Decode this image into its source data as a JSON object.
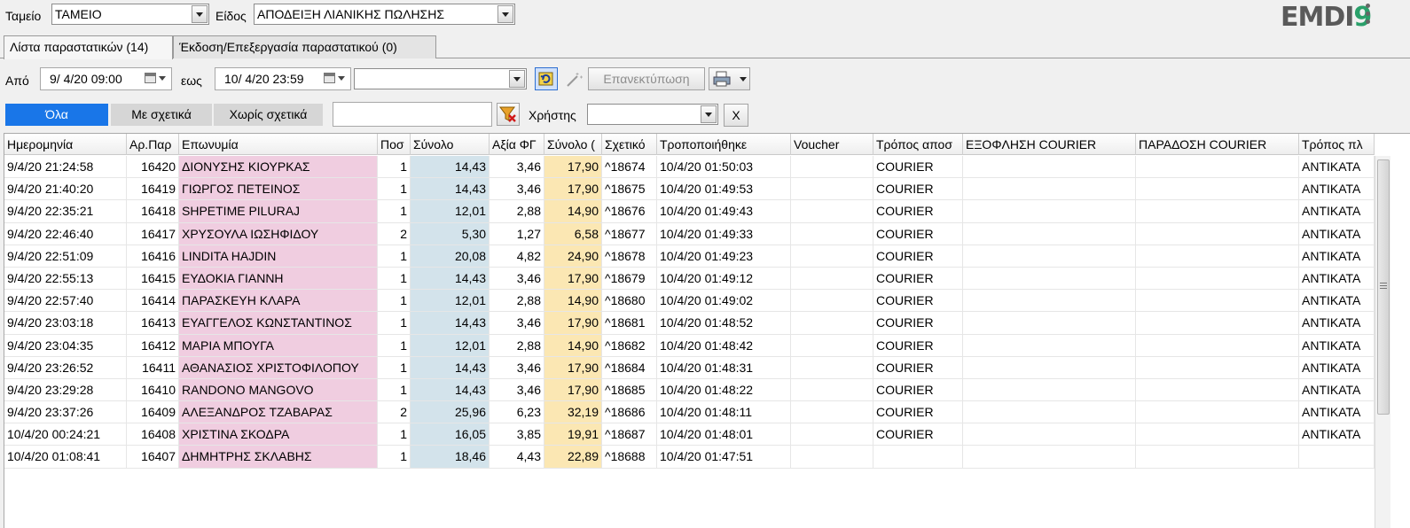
{
  "top": {
    "cashier_label": "Ταμείο",
    "cashier_value": "ΤΑΜΕΙΟ",
    "kind_label": "Είδος",
    "kind_value": "ΑΠΟΔΕΙΞΗ ΛΙΑΝΙΚΗΣ ΠΩΛΗΣΗΣ",
    "logo_text": "EMDI",
    "logo_nine": "9"
  },
  "tabs": [
    {
      "label": "Λίστα παραστατικών (14)",
      "active": true
    },
    {
      "label": "Έκδοση/Επεξεργασία παραστατικού (0)",
      "active": false
    }
  ],
  "date_filter": {
    "from_label": "Από",
    "from_value": "9/  4/20 09:00",
    "to_label": "εως",
    "to_value": "10/  4/20 23:59",
    "combo_value": "",
    "reprint_label": "Επανεκτύπωση"
  },
  "filters": {
    "all": "Όλα",
    "with_related": "Με σχετικά",
    "without_related": "Χωρίς σχετικά",
    "search_value": "",
    "user_label": "Χρήστης",
    "user_value": "",
    "clear_label": "X"
  },
  "table": {
    "columns": [
      "Ημερομηνία",
      "Αρ.Παρ",
      "Επωνυμία",
      "Ποσ",
      "Σύνολο",
      "Αξία ΦΓ",
      "Σύνολο (",
      "Σχετικό",
      "Τροποποιήθηκε",
      "Voucher",
      "Τρόπος αποσ",
      "ΕΞΟΦΛΗΣΗ COURIER",
      "ΠΑΡΑΔΟΣΗ COURIER",
      "Τρόπος πλ"
    ],
    "rows": [
      [
        "9/4/20 21:24:58",
        "16420",
        "ΔΙΟΝΥΣΗΣ ΚΙΟΥΡΚΑΣ",
        "1",
        "14,43",
        "3,46",
        "17,90",
        "^18674",
        "10/4/20 01:50:03",
        "",
        "COURIER",
        "",
        "",
        "ΑΝΤΙΚΑΤΑ"
      ],
      [
        "9/4/20 21:40:20",
        "16419",
        "ΓΙΩΡΓΟΣ ΠΕΤΕΙΝΟΣ",
        "1",
        "14,43",
        "3,46",
        "17,90",
        "^18675",
        "10/4/20 01:49:53",
        "",
        "COURIER",
        "",
        "",
        "ΑΝΤΙΚΑΤΑ"
      ],
      [
        "9/4/20 22:35:21",
        "16418",
        "SHPETIME PILURAJ",
        "1",
        "12,01",
        "2,88",
        "14,90",
        "^18676",
        "10/4/20 01:49:43",
        "",
        "COURIER",
        "",
        "",
        "ΑΝΤΙΚΑΤΑ"
      ],
      [
        "9/4/20 22:46:40",
        "16417",
        "ΧΡΥΣΟΥΛΑ ΙΩΣΗΦΙΔΟΥ",
        "2",
        "5,30",
        "1,27",
        "6,58",
        "^18677",
        "10/4/20 01:49:33",
        "",
        "COURIER",
        "",
        "",
        "ΑΝΤΙΚΑΤΑ"
      ],
      [
        "9/4/20 22:51:09",
        "16416",
        "LINDITA HAJDIN",
        "1",
        "20,08",
        "4,82",
        "24,90",
        "^18678",
        "10/4/20 01:49:23",
        "",
        "COURIER",
        "",
        "",
        "ΑΝΤΙΚΑΤΑ"
      ],
      [
        "9/4/20 22:55:13",
        "16415",
        "ΕΥΔΟΚΙΑ ΓΙΑΝΝΗ",
        "1",
        "14,43",
        "3,46",
        "17,90",
        "^18679",
        "10/4/20 01:49:12",
        "",
        "COURIER",
        "",
        "",
        "ΑΝΤΙΚΑΤΑ"
      ],
      [
        "9/4/20 22:57:40",
        "16414",
        "ΠΑΡΑΣΚΕΥΗ ΚΛΑΡΑ",
        "1",
        "12,01",
        "2,88",
        "14,90",
        "^18680",
        "10/4/20 01:49:02",
        "",
        "COURIER",
        "",
        "",
        "ΑΝΤΙΚΑΤΑ"
      ],
      [
        "9/4/20 23:03:18",
        "16413",
        "ΕΥΑΓΓΕΛΟΣ ΚΩΝΣΤΑΝΤΙΝΟΣ",
        "1",
        "14,43",
        "3,46",
        "17,90",
        "^18681",
        "10/4/20 01:48:52",
        "",
        "COURIER",
        "",
        "",
        "ΑΝΤΙΚΑΤΑ"
      ],
      [
        "9/4/20 23:04:35",
        "16412",
        "ΜΑΡΙΑ ΜΠΟΥΓΑ",
        "1",
        "12,01",
        "2,88",
        "14,90",
        "^18682",
        "10/4/20 01:48:42",
        "",
        "COURIER",
        "",
        "",
        "ΑΝΤΙΚΑΤΑ"
      ],
      [
        "9/4/20 23:26:52",
        "16411",
        "ΑΘΑΝΑΣΙΟΣ ΧΡΙΣΤΟΦΙΛΟΠΟΥ",
        "1",
        "14,43",
        "3,46",
        "17,90",
        "^18684",
        "10/4/20 01:48:31",
        "",
        "COURIER",
        "",
        "",
        "ΑΝΤΙΚΑΤΑ"
      ],
      [
        "9/4/20 23:29:28",
        "16410",
        "RANDONO MANGOVO",
        "1",
        "14,43",
        "3,46",
        "17,90",
        "^18685",
        "10/4/20 01:48:22",
        "",
        "COURIER",
        "",
        "",
        "ΑΝΤΙΚΑΤΑ"
      ],
      [
        "9/4/20 23:37:26",
        "16409",
        "ΑΛΕΞΑΝΔΡΟΣ ΤΖΑΒΑΡΑΣ",
        "2",
        "25,96",
        "6,23",
        "32,19",
        "^18686",
        "10/4/20 01:48:11",
        "",
        "COURIER",
        "",
        "",
        "ΑΝΤΙΚΑΤΑ"
      ],
      [
        "10/4/20 00:24:21",
        "16408",
        "ΧΡΙΣΤΙΝΑ ΣΚΟΔΡΑ",
        "1",
        "16,05",
        "3,85",
        "19,91",
        "^18687",
        "10/4/20 01:48:01",
        "",
        "COURIER",
        "",
        "",
        "ΑΝΤΙΚΑΤΑ"
      ],
      [
        "10/4/20 01:08:41",
        "16407",
        "ΔΗΜΗΤΡΗΣ ΣΚΛΑΒΗΣ",
        "1",
        "18,46",
        "4,43",
        "22,89",
        "^18688",
        "10/4/20 01:47:51",
        "",
        "",
        "",
        "",
        ""
      ]
    ]
  },
  "colors": {
    "accent": "#1976e8",
    "name_column": "#f0cde0",
    "total_column": "#d3e3eb",
    "grand_total_column": "#fbe7b3"
  }
}
